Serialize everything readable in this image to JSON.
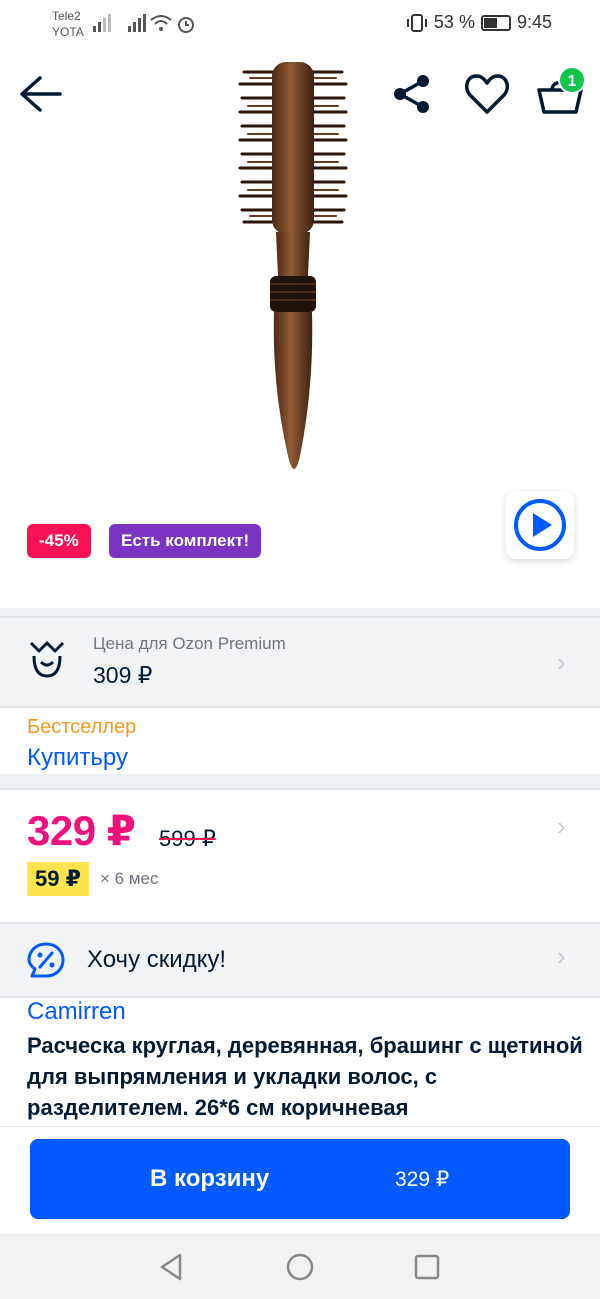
{
  "status_bar": {
    "carrier_1": "Tele2",
    "carrier_2": "YOTA",
    "battery_text": "53 %",
    "battery_level": 0.53,
    "time": "9:45"
  },
  "toolbar": {
    "back_icon": "arrow-left-icon",
    "share_icon": "share-icon",
    "favorite_icon": "heart-icon",
    "cart_icon": "basket-icon",
    "cart_count": "1"
  },
  "product": {
    "image": "round-wooden-hairbrush",
    "discount_badge": "-45%",
    "kit_badge": "Есть комплект!",
    "video_icon": "play-icon",
    "brand": "Camirren",
    "title": "Расческа круглая, деревянная, брашинг с щетиной для выпрямления и укладки волос, с разделителем. 26*6 см коричневая"
  },
  "premium": {
    "icon": "ozon-premium-crown-icon",
    "label": "Цена для Ozon Premium",
    "price": "309 ₽"
  },
  "seller": {
    "bestseller_label": "Бестселлер",
    "name": "Купитьру"
  },
  "pricing": {
    "current_price": "329 ₽",
    "old_price": "599 ₽",
    "installment_price": "59 ₽",
    "installment_term": "× 6 мес"
  },
  "discount_request": {
    "icon": "percent-chat-icon",
    "label": "Хочу скидку!"
  },
  "cart_button": {
    "label": "В корзину",
    "price": "329 ₽"
  },
  "colors": {
    "accent_blue": "#005bff",
    "price_pink": "#f1117e",
    "discount_red": "#f91155",
    "kit_purple": "#7b33c4",
    "bestseller_orange": "#f8971d",
    "installment_yellow": "#fee550",
    "cart_badge_green": "#10c44c"
  }
}
